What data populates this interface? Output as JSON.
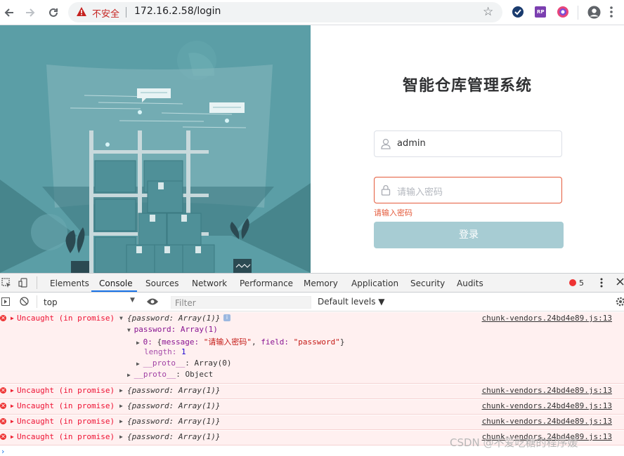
{
  "browser": {
    "insecure_label": "不安全",
    "url": "172.16.2.58/login",
    "ext_rp_label": "RP"
  },
  "login": {
    "title": "智能仓库管理系统",
    "username_value": "admin",
    "password_placeholder": "请输入密码",
    "password_error": "请输入密码",
    "login_button": "登录"
  },
  "devtools": {
    "tabs": [
      "Elements",
      "Console",
      "Sources",
      "Network",
      "Performance",
      "Memory",
      "Application",
      "Security",
      "Audits"
    ],
    "active_tab": "Console",
    "error_count": "5",
    "context": "top",
    "filter_placeholder": "Filter",
    "levels": "Default levels ▼",
    "messages": [
      {
        "text": "Uncaught (in promise)",
        "object": "{password: Array(1)}",
        "source": "chunk-vendors.24bd4e89.js:13"
      },
      {
        "text": "Uncaught (in promise)",
        "object": "{password: Array(1)}",
        "source": "chunk-vendors.24bd4e89.js:13"
      },
      {
        "text": "Uncaught (in promise)",
        "object": "{password: Array(1)}",
        "source": "chunk-vendors.24bd4e89.js:13"
      },
      {
        "text": "Uncaught (in promise)",
        "object": "{password: Array(1)}",
        "source": "chunk-vendors.24bd4e89.js:13"
      },
      {
        "text": "Uncaught (in promise)",
        "object": "{password: Array(1)}",
        "source": "chunk-vendors.24bd4e89.js:13"
      }
    ],
    "expanded": {
      "password_line": "password: Array(1)",
      "item_index": "0:",
      "item_message_key": "message:",
      "item_message_value": "\"请输入密码\"",
      "item_field_key": "field:",
      "item_field_value": "\"password\"",
      "length_key": "length:",
      "length_value": "1",
      "proto_array": "__proto__",
      "proto_array_value": ": Array(0)",
      "proto_object": "__proto__",
      "proto_object_value": ": Object"
    }
  },
  "watermark": "CSDN @不爱吃糖的程序媛"
}
